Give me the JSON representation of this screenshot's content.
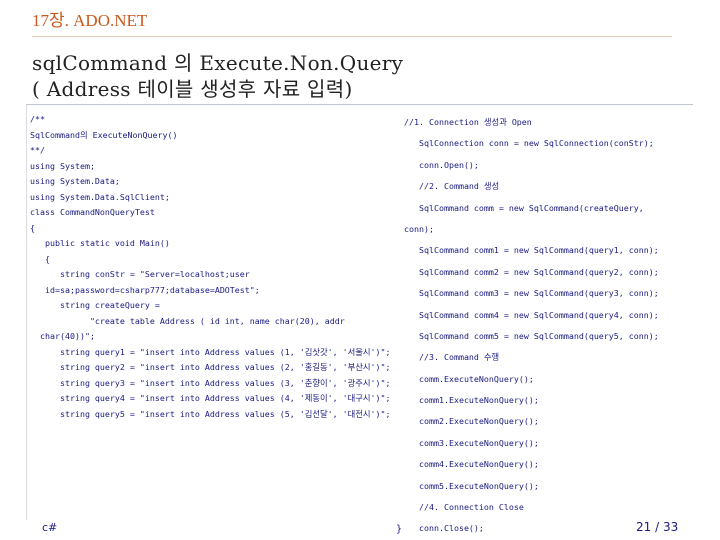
{
  "header": {
    "chapter": "17장. ADO.NET",
    "title_line1": "sqlCommand 의 Execute.Non.Query",
    "title_line2": "( Address 테이블 생성후 자료 입력)"
  },
  "code_left": [
    "/**",
    "SqlCommand의 ExecuteNonQuery()",
    "**/",
    "using System;",
    "using System.Data;",
    "using System.Data.SqlClient;",
    "class CommandNonQueryTest",
    "{",
    "   public static void Main()",
    "   {",
    "      string conStr = \"Server=localhost;user",
    "   id=sa;password=csharp777;database=ADOTest\";",
    "      string createQuery =",
    "            \"create table Address ( id int, name char(20), addr",
    "  char(40))\";",
    "      string query1 = \"insert into Address values (1, '김삿갓', '서울시')\";",
    "      string query2 = \"insert into Address values (2, '홍길동', '부산시')\";",
    "      string query3 = \"insert into Address values (3, '춘향이', '광주시')\";",
    "      string query4 = \"insert into Address values (4, '제동이', '대구시')\";",
    "      string query5 = \"insert into Address values (5, '김선달', '대전시')\";"
  ],
  "code_right": [
    "//1. Connection 생성과 Open",
    "   SqlConnection conn = new SqlConnection(conStr);",
    "   conn.Open();",
    "   //2. Command 생성",
    "   SqlCommand comm = new SqlCommand(createQuery,",
    "conn);",
    "   SqlCommand comm1 = new SqlCommand(query1, conn);",
    "   SqlCommand comm2 = new SqlCommand(query2, conn);",
    "   SqlCommand comm3 = new SqlCommand(query3, conn);",
    "   SqlCommand comm4 = new SqlCommand(query4, conn);",
    "   SqlCommand comm5 = new SqlCommand(query5, conn);",
    "   //3. Command 수행",
    "   comm.ExecuteNonQuery();",
    "   comm1.ExecuteNonQuery();",
    "   comm2.ExecuteNonQuery();",
    "   comm3.ExecuteNonQuery();",
    "   comm4.ExecuteNonQuery();",
    "   comm5.ExecuteNonQuery();",
    "   //4. Connection Close",
    "   conn.Close();"
  ],
  "footer": {
    "language": "c#",
    "brace": "}",
    "page": "21 / 33"
  },
  "colors": {
    "chapter": "#c75a1e",
    "code": "#1a1a80",
    "title": "#222222"
  }
}
